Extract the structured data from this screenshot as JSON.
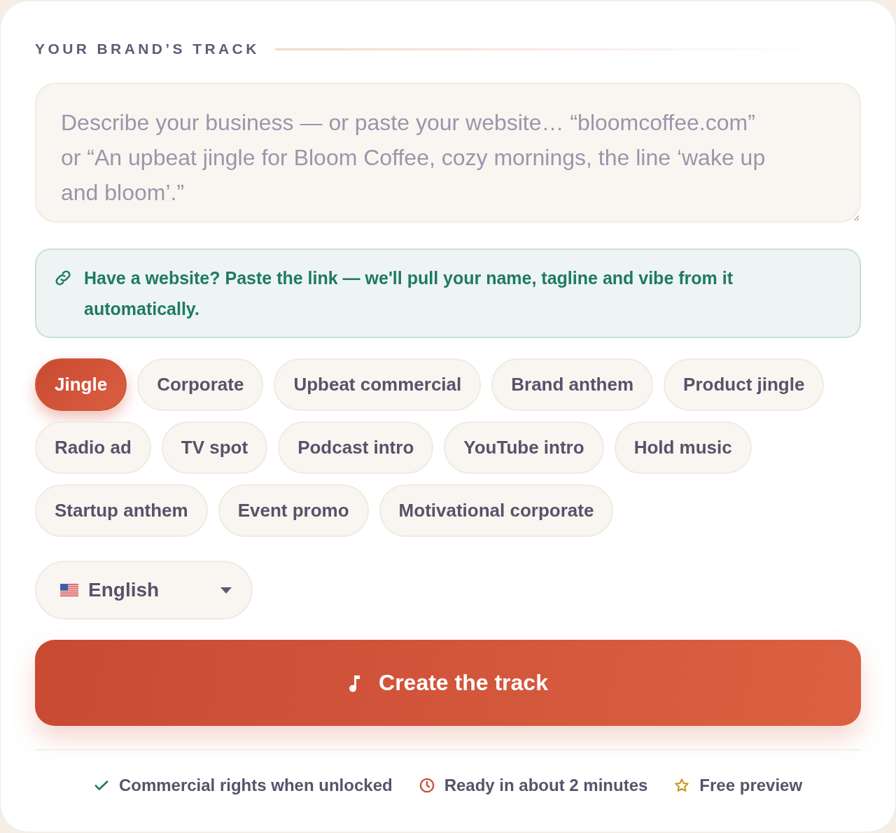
{
  "section_title": "YOUR BRAND’S TRACK",
  "description_field": {
    "placeholder": "Describe your business — or paste your website… “bloomcoffee.com” or “An upbeat jingle for Bloom Coffee, cozy mornings, the line ‘wake up and bloom’.”"
  },
  "website_hint": {
    "text": "Have a website? Paste the link — we'll pull your name, tagline and vibe from it automatically."
  },
  "styles": [
    {
      "label": "Jingle",
      "selected": true
    },
    {
      "label": "Corporate",
      "selected": false
    },
    {
      "label": "Upbeat commercial",
      "selected": false
    },
    {
      "label": "Brand anthem",
      "selected": false
    },
    {
      "label": "Product jingle",
      "selected": false
    },
    {
      "label": "Radio ad",
      "selected": false
    },
    {
      "label": "TV spot",
      "selected": false
    },
    {
      "label": "Podcast intro",
      "selected": false
    },
    {
      "label": "YouTube intro",
      "selected": false
    },
    {
      "label": "Hold music",
      "selected": false
    },
    {
      "label": "Startup anthem",
      "selected": false
    },
    {
      "label": "Event promo",
      "selected": false
    },
    {
      "label": "Motivational corporate",
      "selected": false
    }
  ],
  "language_select": {
    "value": "English"
  },
  "create_button": {
    "label": "Create the track"
  },
  "perks": [
    {
      "kind": "check",
      "color": "#1f7a64",
      "text": "Commercial rights when unlocked"
    },
    {
      "kind": "clock",
      "color": "#c4503a",
      "text": "Ready in about 2 minutes"
    },
    {
      "kind": "star",
      "color": "#c9961a",
      "text": "Free preview"
    }
  ]
}
